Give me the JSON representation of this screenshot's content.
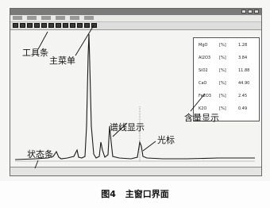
{
  "annotations": {
    "toolbar": "工具条",
    "main_menu": "主菜单",
    "spectrum_display": "谱线显示",
    "cursor": "光标",
    "content_display": "含量显示",
    "status_bar": "状态条"
  },
  "content_panel": {
    "rows": [
      {
        "name": "MgO",
        "unit": "[%]",
        "value": "1.28"
      },
      {
        "name": "Al2O3",
        "unit": "[%]",
        "value": "3.84"
      },
      {
        "name": "SiO2",
        "unit": "[%]",
        "value": "11.88"
      },
      {
        "name": "CaO",
        "unit": "[%]",
        "value": "44.90"
      },
      {
        "name": "Fe2O3",
        "unit": "[%]",
        "value": "2.45"
      },
      {
        "name": "K2O",
        "unit": "[%]",
        "value": "0.49"
      }
    ]
  },
  "caption": {
    "figure": "图4",
    "title": "主窗口界面"
  },
  "colors": {
    "spectrum_line": "#1a1a1a",
    "background": "#f3f3f1"
  }
}
